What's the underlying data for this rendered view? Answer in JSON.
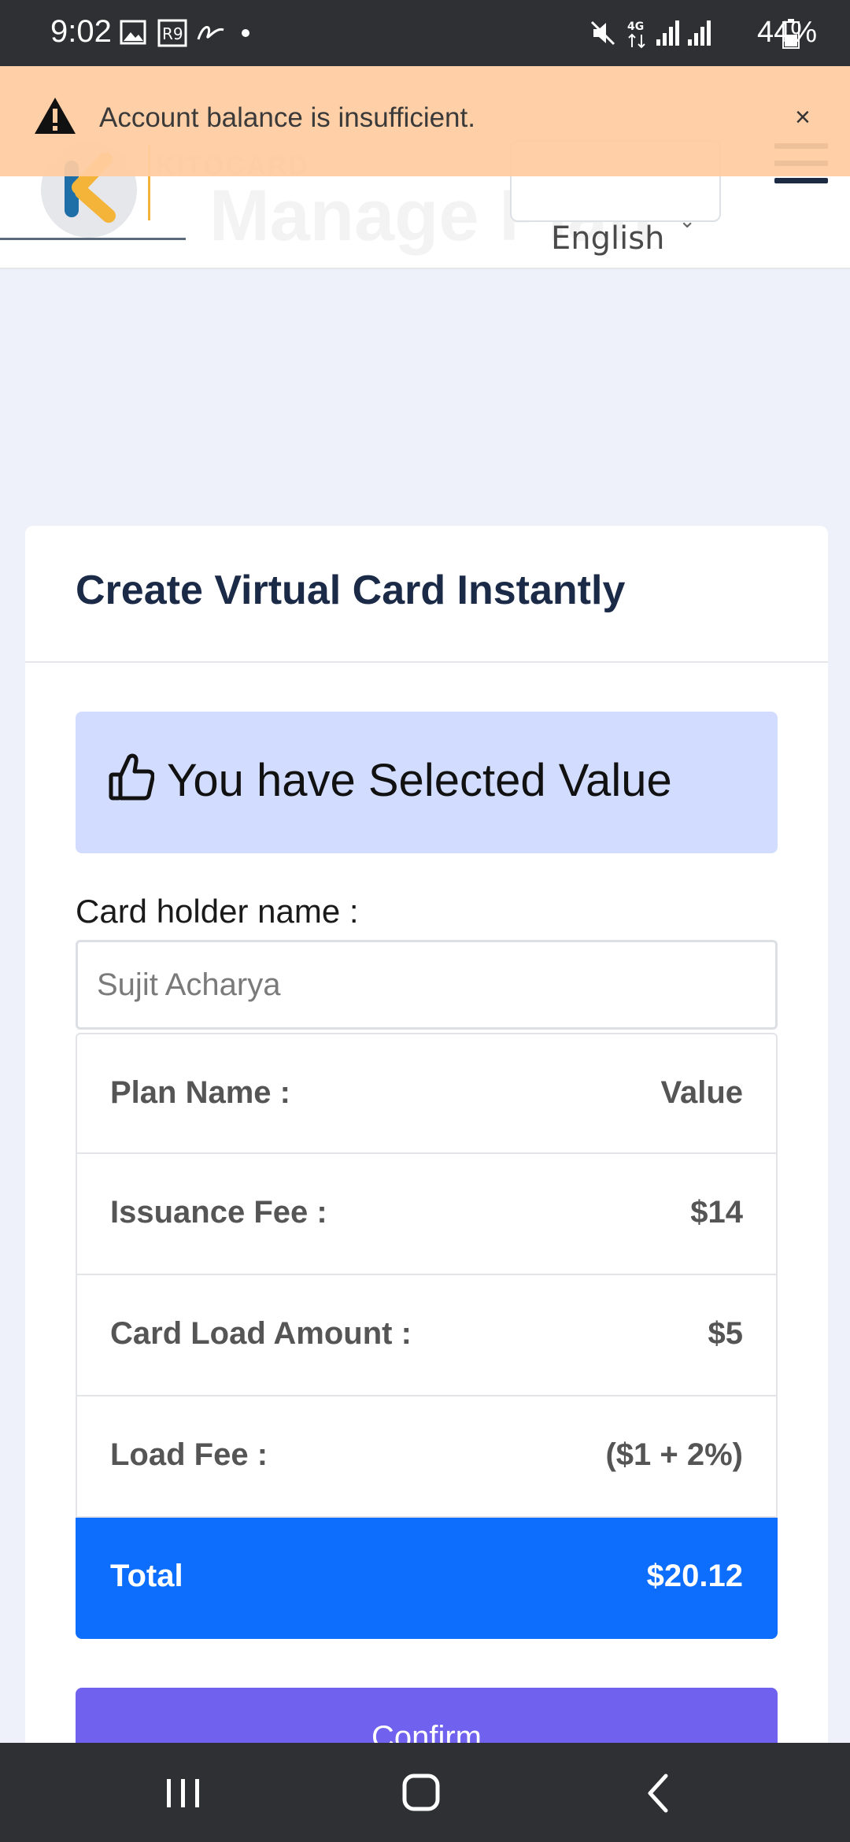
{
  "status_bar": {
    "time": "9:02",
    "battery": "44%",
    "network": "4G",
    "notif_icons": [
      "image-icon",
      "r9-icon",
      "scribble-icon",
      "dot-icon"
    ],
    "system_icons": [
      "mute-icon",
      "4g-icon",
      "signal-icon",
      "signal-icon",
      "battery-icon"
    ]
  },
  "header": {
    "brand": "KITOCARD",
    "page_title": "Manage Plan",
    "language": "English",
    "brand_colors": {
      "k_blue": "#1e6fa8",
      "k_orange": "#f4b43a"
    }
  },
  "toast": {
    "message": "Account balance is insufficient.",
    "close_label": "×",
    "background": "#ffcca0"
  },
  "card": {
    "title": "Create Virtual Card Instantly",
    "selected_text": "You have Selected Value",
    "holder_label": "Card holder name :",
    "holder_value": "Sujit Acharya",
    "summary": [
      {
        "key": "Plan Name :",
        "value": "Value"
      },
      {
        "key": "Issuance Fee :",
        "value": "$14"
      },
      {
        "key": "Card Load Amount :",
        "value": "$5"
      },
      {
        "key": "Load Fee :",
        "value": "($1 + 2%)"
      },
      {
        "key": "Total",
        "value": "$20.12"
      }
    ],
    "confirm_label": "Confirm",
    "colors": {
      "total_bg": "#0d6efd",
      "confirm_bg": "#7062ee",
      "banner_bg": "#d2dcfe"
    }
  },
  "nav_bar": {
    "buttons": [
      "recent-apps",
      "home",
      "back"
    ]
  }
}
